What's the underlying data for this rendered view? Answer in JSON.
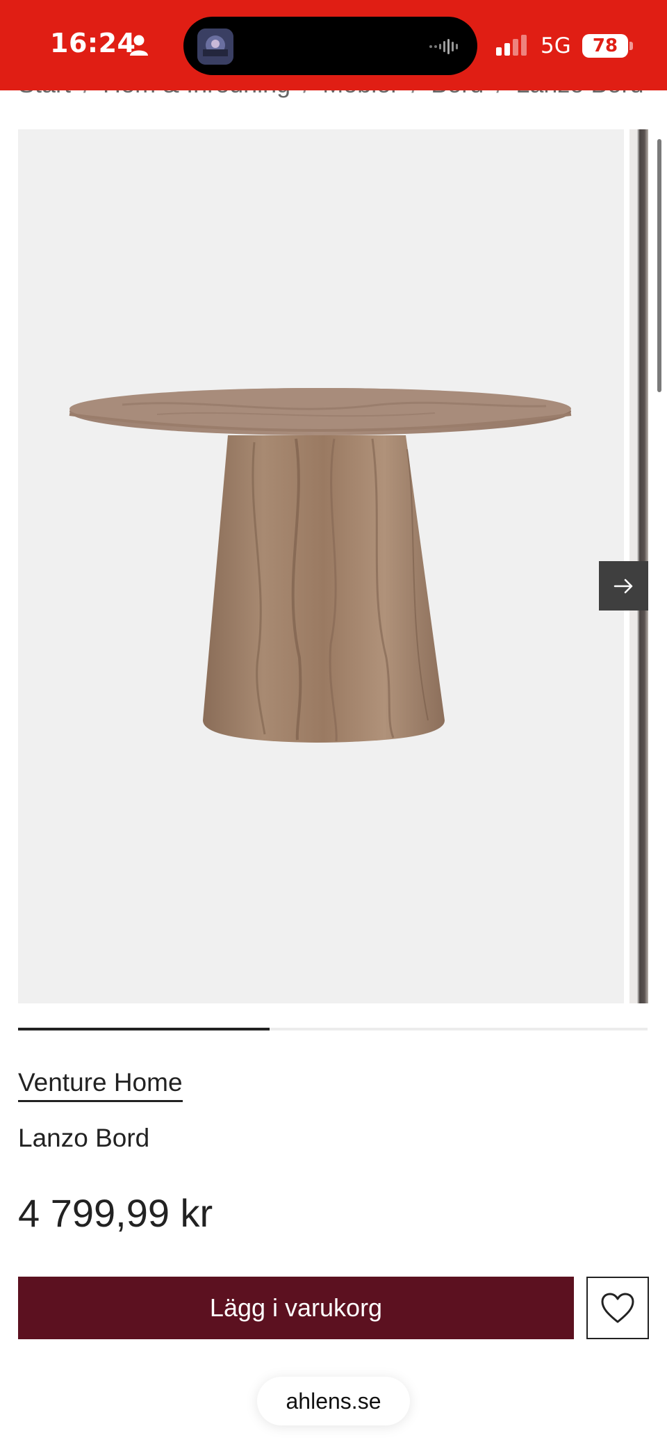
{
  "status_bar": {
    "time": "16:24",
    "network": "5G",
    "battery_level": "78",
    "background_color": "#e01e14",
    "icons": [
      "person-icon",
      "music-thumbnail-icon",
      "audio-wave-icon",
      "cellular-signal-icon",
      "battery-icon"
    ]
  },
  "breadcrumb": {
    "items": [
      "Start",
      "Hem & Inredning",
      "Möbler",
      "Bord",
      "Lanzo Bord"
    ],
    "separator": "/"
  },
  "gallery": {
    "next_icon": "arrow-right-icon",
    "progress_fraction": 0.4,
    "background_color": "#f0f0f0"
  },
  "product": {
    "brand": "Venture Home",
    "name": "Lanzo Bord",
    "price": "4 799,99 kr"
  },
  "actions": {
    "add_to_cart_label": "Lägg i varukorg",
    "add_to_cart_color": "#5c1120",
    "wishlist_icon": "heart-icon"
  },
  "browser": {
    "url": "ahlens.se"
  }
}
